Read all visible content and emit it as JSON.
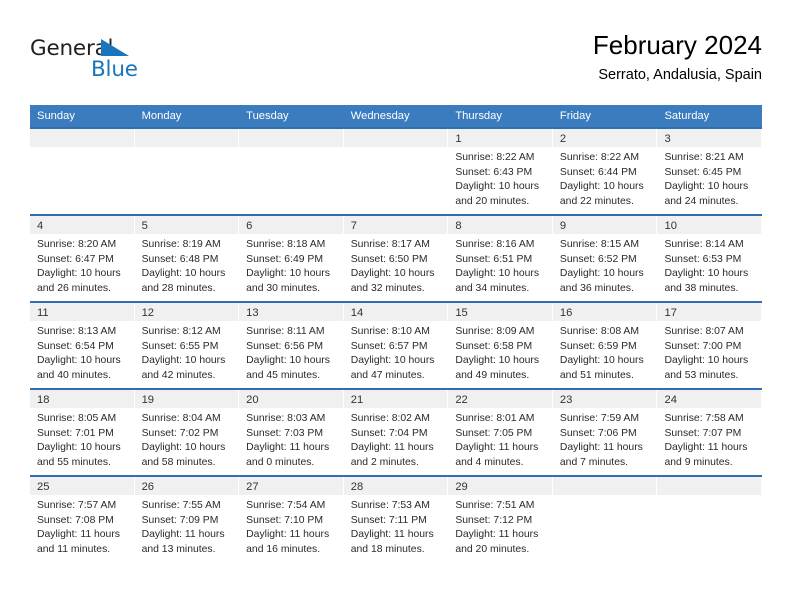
{
  "brand": {
    "name_part1": "General",
    "name_part2": "Blue",
    "accent_color": "#1b75bb"
  },
  "header": {
    "title": "February 2024",
    "subtitle": "Serrato, Andalusia, Spain"
  },
  "calendar": {
    "header_color": "#3a7cbe",
    "weekdays": [
      "Sunday",
      "Monday",
      "Tuesday",
      "Wednesday",
      "Thursday",
      "Friday",
      "Saturday"
    ],
    "weeks": [
      [
        {
          "day": "",
          "lines": []
        },
        {
          "day": "",
          "lines": []
        },
        {
          "day": "",
          "lines": []
        },
        {
          "day": "",
          "lines": []
        },
        {
          "day": "1",
          "lines": [
            "Sunrise: 8:22 AM",
            "Sunset: 6:43 PM",
            "Daylight: 10 hours",
            "and 20 minutes."
          ]
        },
        {
          "day": "2",
          "lines": [
            "Sunrise: 8:22 AM",
            "Sunset: 6:44 PM",
            "Daylight: 10 hours",
            "and 22 minutes."
          ]
        },
        {
          "day": "3",
          "lines": [
            "Sunrise: 8:21 AM",
            "Sunset: 6:45 PM",
            "Daylight: 10 hours",
            "and 24 minutes."
          ]
        }
      ],
      [
        {
          "day": "4",
          "lines": [
            "Sunrise: 8:20 AM",
            "Sunset: 6:47 PM",
            "Daylight: 10 hours",
            "and 26 minutes."
          ]
        },
        {
          "day": "5",
          "lines": [
            "Sunrise: 8:19 AM",
            "Sunset: 6:48 PM",
            "Daylight: 10 hours",
            "and 28 minutes."
          ]
        },
        {
          "day": "6",
          "lines": [
            "Sunrise: 8:18 AM",
            "Sunset: 6:49 PM",
            "Daylight: 10 hours",
            "and 30 minutes."
          ]
        },
        {
          "day": "7",
          "lines": [
            "Sunrise: 8:17 AM",
            "Sunset: 6:50 PM",
            "Daylight: 10 hours",
            "and 32 minutes."
          ]
        },
        {
          "day": "8",
          "lines": [
            "Sunrise: 8:16 AM",
            "Sunset: 6:51 PM",
            "Daylight: 10 hours",
            "and 34 minutes."
          ]
        },
        {
          "day": "9",
          "lines": [
            "Sunrise: 8:15 AM",
            "Sunset: 6:52 PM",
            "Daylight: 10 hours",
            "and 36 minutes."
          ]
        },
        {
          "day": "10",
          "lines": [
            "Sunrise: 8:14 AM",
            "Sunset: 6:53 PM",
            "Daylight: 10 hours",
            "and 38 minutes."
          ]
        }
      ],
      [
        {
          "day": "11",
          "lines": [
            "Sunrise: 8:13 AM",
            "Sunset: 6:54 PM",
            "Daylight: 10 hours",
            "and 40 minutes."
          ]
        },
        {
          "day": "12",
          "lines": [
            "Sunrise: 8:12 AM",
            "Sunset: 6:55 PM",
            "Daylight: 10 hours",
            "and 42 minutes."
          ]
        },
        {
          "day": "13",
          "lines": [
            "Sunrise: 8:11 AM",
            "Sunset: 6:56 PM",
            "Daylight: 10 hours",
            "and 45 minutes."
          ]
        },
        {
          "day": "14",
          "lines": [
            "Sunrise: 8:10 AM",
            "Sunset: 6:57 PM",
            "Daylight: 10 hours",
            "and 47 minutes."
          ]
        },
        {
          "day": "15",
          "lines": [
            "Sunrise: 8:09 AM",
            "Sunset: 6:58 PM",
            "Daylight: 10 hours",
            "and 49 minutes."
          ]
        },
        {
          "day": "16",
          "lines": [
            "Sunrise: 8:08 AM",
            "Sunset: 6:59 PM",
            "Daylight: 10 hours",
            "and 51 minutes."
          ]
        },
        {
          "day": "17",
          "lines": [
            "Sunrise: 8:07 AM",
            "Sunset: 7:00 PM",
            "Daylight: 10 hours",
            "and 53 minutes."
          ]
        }
      ],
      [
        {
          "day": "18",
          "lines": [
            "Sunrise: 8:05 AM",
            "Sunset: 7:01 PM",
            "Daylight: 10 hours",
            "and 55 minutes."
          ]
        },
        {
          "day": "19",
          "lines": [
            "Sunrise: 8:04 AM",
            "Sunset: 7:02 PM",
            "Daylight: 10 hours",
            "and 58 minutes."
          ]
        },
        {
          "day": "20",
          "lines": [
            "Sunrise: 8:03 AM",
            "Sunset: 7:03 PM",
            "Daylight: 11 hours",
            "and 0 minutes."
          ]
        },
        {
          "day": "21",
          "lines": [
            "Sunrise: 8:02 AM",
            "Sunset: 7:04 PM",
            "Daylight: 11 hours",
            "and 2 minutes."
          ]
        },
        {
          "day": "22",
          "lines": [
            "Sunrise: 8:01 AM",
            "Sunset: 7:05 PM",
            "Daylight: 11 hours",
            "and 4 minutes."
          ]
        },
        {
          "day": "23",
          "lines": [
            "Sunrise: 7:59 AM",
            "Sunset: 7:06 PM",
            "Daylight: 11 hours",
            "and 7 minutes."
          ]
        },
        {
          "day": "24",
          "lines": [
            "Sunrise: 7:58 AM",
            "Sunset: 7:07 PM",
            "Daylight: 11 hours",
            "and 9 minutes."
          ]
        }
      ],
      [
        {
          "day": "25",
          "lines": [
            "Sunrise: 7:57 AM",
            "Sunset: 7:08 PM",
            "Daylight: 11 hours",
            "and 11 minutes."
          ]
        },
        {
          "day": "26",
          "lines": [
            "Sunrise: 7:55 AM",
            "Sunset: 7:09 PM",
            "Daylight: 11 hours",
            "and 13 minutes."
          ]
        },
        {
          "day": "27",
          "lines": [
            "Sunrise: 7:54 AM",
            "Sunset: 7:10 PM",
            "Daylight: 11 hours",
            "and 16 minutes."
          ]
        },
        {
          "day": "28",
          "lines": [
            "Sunrise: 7:53 AM",
            "Sunset: 7:11 PM",
            "Daylight: 11 hours",
            "and 18 minutes."
          ]
        },
        {
          "day": "29",
          "lines": [
            "Sunrise: 7:51 AM",
            "Sunset: 7:12 PM",
            "Daylight: 11 hours",
            "and 20 minutes."
          ]
        },
        {
          "day": "",
          "lines": []
        },
        {
          "day": "",
          "lines": []
        }
      ]
    ]
  }
}
